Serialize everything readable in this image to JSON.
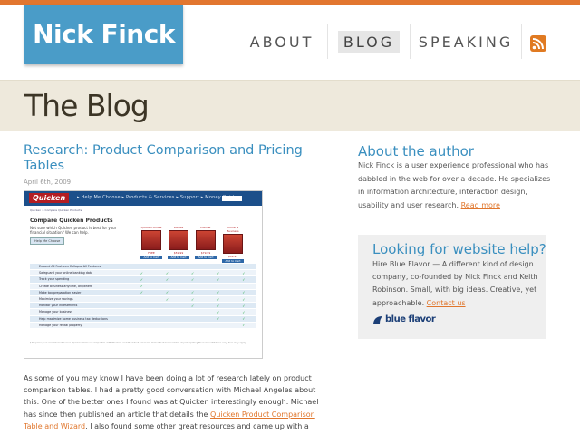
{
  "header": {
    "logo": "Nick Finck",
    "nav": [
      "ABOUT",
      "BLOG",
      "SPEAKING"
    ],
    "active_nav": "BLOG",
    "rss_icon": "rss-icon",
    "accent_color": "#e2762f",
    "logo_color": "#4a9cc8"
  },
  "banner": {
    "title": "The Blog"
  },
  "post": {
    "title": "Research: Product Comparison and Pricing Tables",
    "date": "April 6th, 2009",
    "screenshot": {
      "brand": "Quicken",
      "menu": "▸ Help Me Choose   ▸ Products & Services   ▸ Support   ▸ Money Guide",
      "crumb": "Quicken > Compare Quicken Products",
      "heading": "Compare Quicken Products",
      "intro": "Not sure which Quicken product is best for your financial situation? We can help.",
      "help_button": "Help Me Choose",
      "products": [
        {
          "name": "Quicken Online",
          "price": "FREE"
        },
        {
          "name": "Deluxe",
          "price": "$59.99"
        },
        {
          "name": "Premier",
          "price": "$79.99"
        },
        {
          "name": "Home & Business",
          "price": "$89.99"
        },
        {
          "name": "Rental Property Manager",
          "price": "$149.99"
        }
      ],
      "add_label": "Add to Cart",
      "rows": [
        {
          "label": "Expand All Features    Collapse All Features",
          "checks": [
            false,
            false,
            false,
            false,
            false
          ]
        },
        {
          "label": "Safeguard your online banking data",
          "checks": [
            true,
            true,
            true,
            true,
            true
          ]
        },
        {
          "label": "Track your spending",
          "checks": [
            true,
            true,
            true,
            true,
            true
          ]
        },
        {
          "label": "Create business anytime, anywhere",
          "checks": [
            true,
            false,
            false,
            false,
            false
          ]
        },
        {
          "label": "Make tax preparation easier",
          "checks": [
            true,
            true,
            true,
            true,
            true
          ]
        },
        {
          "label": "Maximize your savings",
          "checks": [
            false,
            true,
            true,
            true,
            true
          ]
        },
        {
          "label": "Monitor your investments",
          "checks": [
            false,
            false,
            true,
            true,
            true
          ]
        },
        {
          "label": "Manage your business",
          "checks": [
            false,
            false,
            false,
            true,
            true
          ]
        },
        {
          "label": "Help maximize home business tax deductions",
          "checks": [
            false,
            false,
            false,
            true,
            true
          ]
        },
        {
          "label": "Manage your rental property",
          "checks": [
            false,
            false,
            false,
            false,
            true
          ]
        }
      ],
      "footnote": "† Requires your own Internet access. Quicken Online is compatible with Windows and Macintosh browsers. Online features available at participating financial institutions only; fees may apply."
    },
    "body_parts": [
      "As some of you may know I have been doing a lot of research lately on product comparison tables.  I had a pretty good conversation with Michael Angeles about this. One of the better ones I found was at Quicken interestingly enough.  Michael has since then published an article that details the ",
      "Quicken Product Comparison Table and Wizard",
      ". I also found some other great resources and came up with a few conclusions"
    ]
  },
  "sidebar": {
    "about_title": "About the author",
    "about_text": "Nick Finck is a user experience professional who has dabbled in the web for over a decade. He specializes in information architecture, interaction design, usability and user research. ",
    "about_link": "Read more",
    "hire_title": "Looking for website help?",
    "hire_text": "Hire Blue Flavor — A different kind of design company, co-founded by Nick Finck and Keith Robinson. Small, with big ideas. Creative, yet approachable. ",
    "hire_link": "Contact us",
    "brand": "blue flavor"
  }
}
